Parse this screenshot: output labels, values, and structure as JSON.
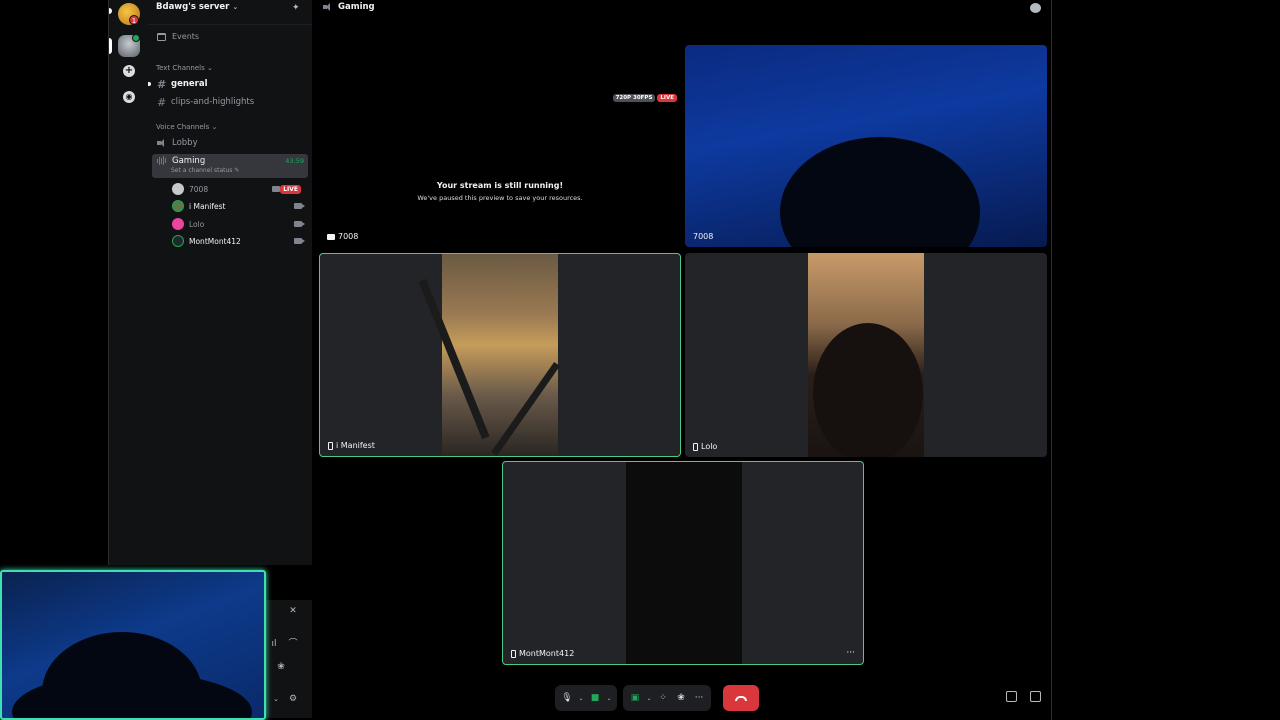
{
  "server": {
    "name": "Bdawg's server",
    "badge_count": "1"
  },
  "sidebar": {
    "events_label": "Events",
    "text_category": "Text Channels",
    "voice_category": "Voice Channels",
    "text_channels": [
      {
        "name": "general"
      },
      {
        "name": "clips-and-highlights"
      }
    ],
    "voice_channels": [
      {
        "name": "Lobby"
      },
      {
        "name": "Gaming",
        "timer": "43:59",
        "status_placeholder": "Set a channel status"
      }
    ],
    "voice_users": [
      {
        "name": "7008",
        "badge": "LIVE"
      },
      {
        "name": "i Manifest"
      },
      {
        "name": "Lolo"
      },
      {
        "name": "MontMont412"
      }
    ]
  },
  "stage": {
    "channel_name": "Gaming",
    "stream_tile": {
      "title": "Your stream is still running!",
      "subtitle": "We've paused this preview to save your resources.",
      "quality": "720P 30FPS",
      "live": "LIVE",
      "user": "7008"
    },
    "tiles": [
      {
        "user": "7008"
      },
      {
        "user": "i Manifest"
      },
      {
        "user": "Lolo"
      },
      {
        "user": "MontMont412"
      }
    ],
    "more_label": "···"
  },
  "colors": {
    "live": "#da373c",
    "speaking": "#4ec98a",
    "online": "#23a55a",
    "self_view_border": "#3ee0b0"
  },
  "icons": [
    "speaker-icon",
    "hash-icon",
    "calendar-icon",
    "camera-icon",
    "mic-icon",
    "screen-share-icon",
    "activity-icon",
    "soundboard-icon",
    "more-icon",
    "hangup-icon",
    "popout-icon",
    "fullscreen-icon",
    "chat-icon",
    "invite-icon",
    "settings-icon"
  ]
}
